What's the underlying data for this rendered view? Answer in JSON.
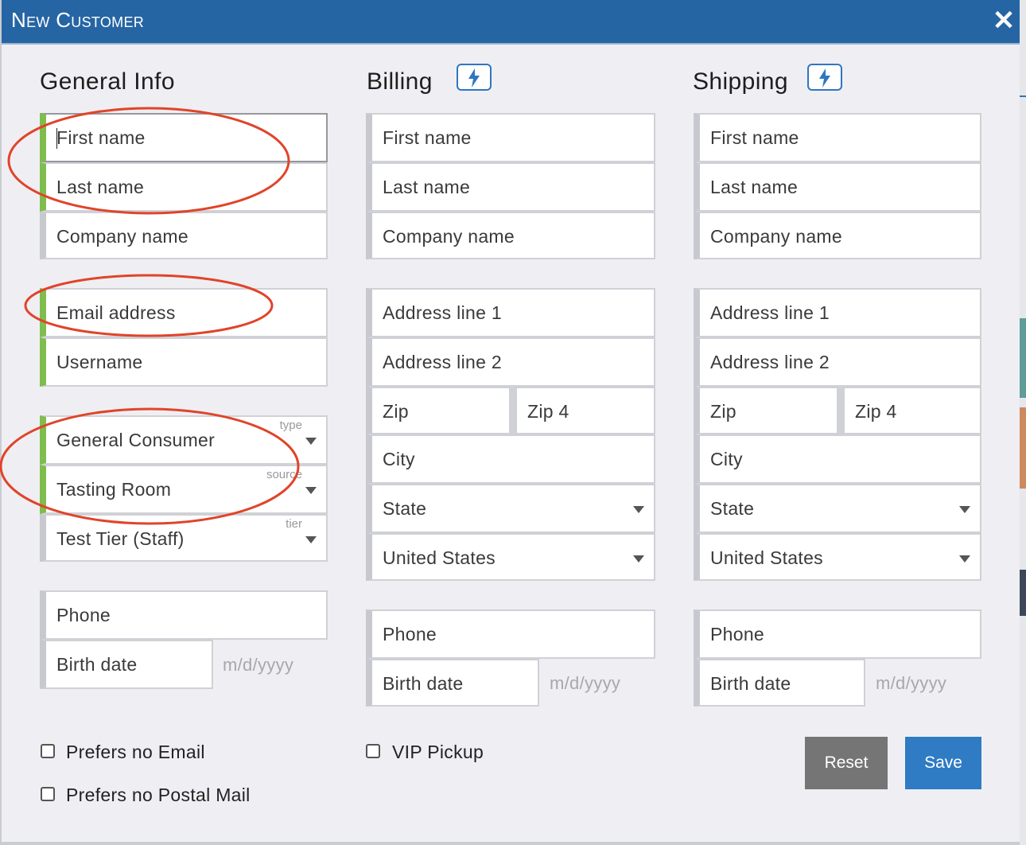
{
  "dialog": {
    "title": "New Customer"
  },
  "general": {
    "heading": "General Info",
    "first_name": "First name",
    "last_name": "Last name",
    "company_name": "Company name",
    "email": "Email address",
    "username": "Username",
    "type_label": "type",
    "type_value": "General Consumer",
    "source_label": "source",
    "source_value": "Tasting Room",
    "tier_label": "tier",
    "tier_value": "Test Tier (Staff)",
    "phone": "Phone",
    "birth_date": "Birth date",
    "date_format": "m/d/yyyy"
  },
  "billing": {
    "heading": "Billing",
    "first_name": "First name",
    "last_name": "Last name",
    "company_name": "Company name",
    "address1": "Address line 1",
    "address2": "Address line 2",
    "zip": "Zip",
    "zip4": "Zip 4",
    "city": "City",
    "state": "State",
    "country": "United States",
    "phone": "Phone",
    "birth_date": "Birth date",
    "date_format": "m/d/yyyy"
  },
  "shipping": {
    "heading": "Shipping",
    "first_name": "First name",
    "last_name": "Last name",
    "company_name": "Company name",
    "address1": "Address line 1",
    "address2": "Address line 2",
    "zip": "Zip",
    "zip4": "Zip 4",
    "city": "City",
    "state": "State",
    "country": "United States",
    "phone": "Phone",
    "birth_date": "Birth date",
    "date_format": "m/d/yyyy"
  },
  "options": {
    "no_email": "Prefers no Email",
    "no_postal": "Prefers no Postal Mail",
    "vip_pickup": "VIP Pickup"
  },
  "buttons": {
    "reset": "Reset",
    "save": "Save"
  },
  "colors": {
    "header": "#2665a4",
    "accent": "#2f76c0",
    "required": "#7fbd4e",
    "annotation": "#e0442a",
    "reset": "#757575"
  },
  "icons": {
    "close": "close-icon",
    "autofill": "lightning-bolt-icon"
  }
}
